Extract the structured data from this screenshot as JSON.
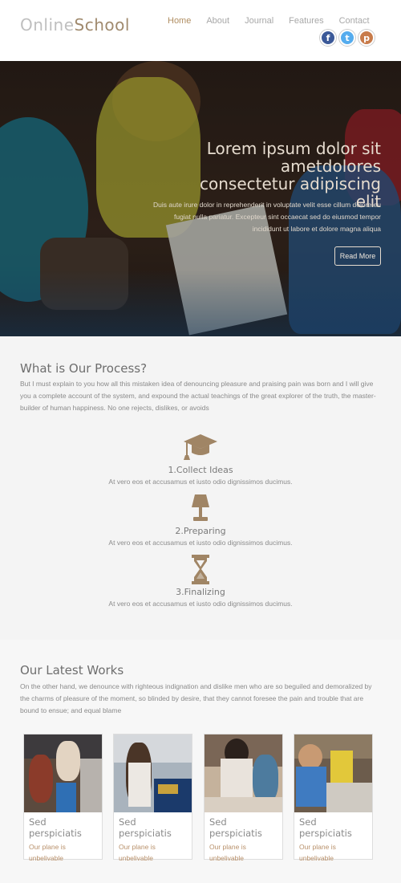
{
  "header": {
    "logo_part1": "Online",
    "logo_part2": "School",
    "nav": [
      "Home",
      "About",
      "Journal",
      "Features",
      "Contact"
    ],
    "social": [
      {
        "icon": "facebook-icon",
        "glyph": "f"
      },
      {
        "icon": "twitter-icon",
        "glyph": "t"
      },
      {
        "icon": "pinterest-icon",
        "glyph": "p"
      }
    ]
  },
  "hero": {
    "title_line1": "Lorem ipsum dolor sit",
    "title_line2": "ametdolores",
    "title_line3": "consectetur adipiscing elit",
    "text": "Duis aute irure dolor in reprehenderit in voluptate velit esse cillum dolore eu fugiat nulla pariatur. Excepteur sint occaecat sed do eiusmod tempor incididunt ut labore et dolore magna aliqua",
    "button": "Read More"
  },
  "process": {
    "title": "What is Our Process?",
    "text": "But I must explain to you how all this mistaken idea of denouncing pleasure and praising pain was born and I will give you a complete account of the system, and expound the actual teachings of the great explorer of the truth, the master-builder of human happiness. No one rejects, dislikes, or avoids",
    "steps": [
      {
        "icon": "graduation-cap-icon",
        "name": "1.Collect Ideas",
        "desc": "At vero eos et accusamus et iusto odio dignissimos ducimus."
      },
      {
        "icon": "lamp-icon",
        "name": "2.Preparing",
        "desc": "At vero eos et accusamus et iusto odio dignissimos ducimus."
      },
      {
        "icon": "hourglass-icon",
        "name": "3.Finalizing",
        "desc": "At vero eos et accusamus et iusto odio dignissimos ducimus."
      }
    ]
  },
  "works": {
    "title": "Our Latest Works",
    "text": "On the other hand, we denounce with righteous indignation and dislike men who are so beguiled and demoralized by the charms of pleasure of the moment, so blinded by desire, that they cannot foresee the pain and trouble that are bound to ensue; and equal blame",
    "cards": [
      {
        "caption": "Sed perspiciatis",
        "sub": "Our plane is unbelivable"
      },
      {
        "caption": "Sed perspiciatis",
        "sub": "Our plane is unbelivable"
      },
      {
        "caption": "Sed perspiciatis",
        "sub": "Our plane is unbelivable"
      },
      {
        "caption": "Sed perspiciatis",
        "sub": "Our plane is unbelivable"
      }
    ]
  },
  "colors": {
    "accent": "#b08e62",
    "icon": "#a08565"
  }
}
